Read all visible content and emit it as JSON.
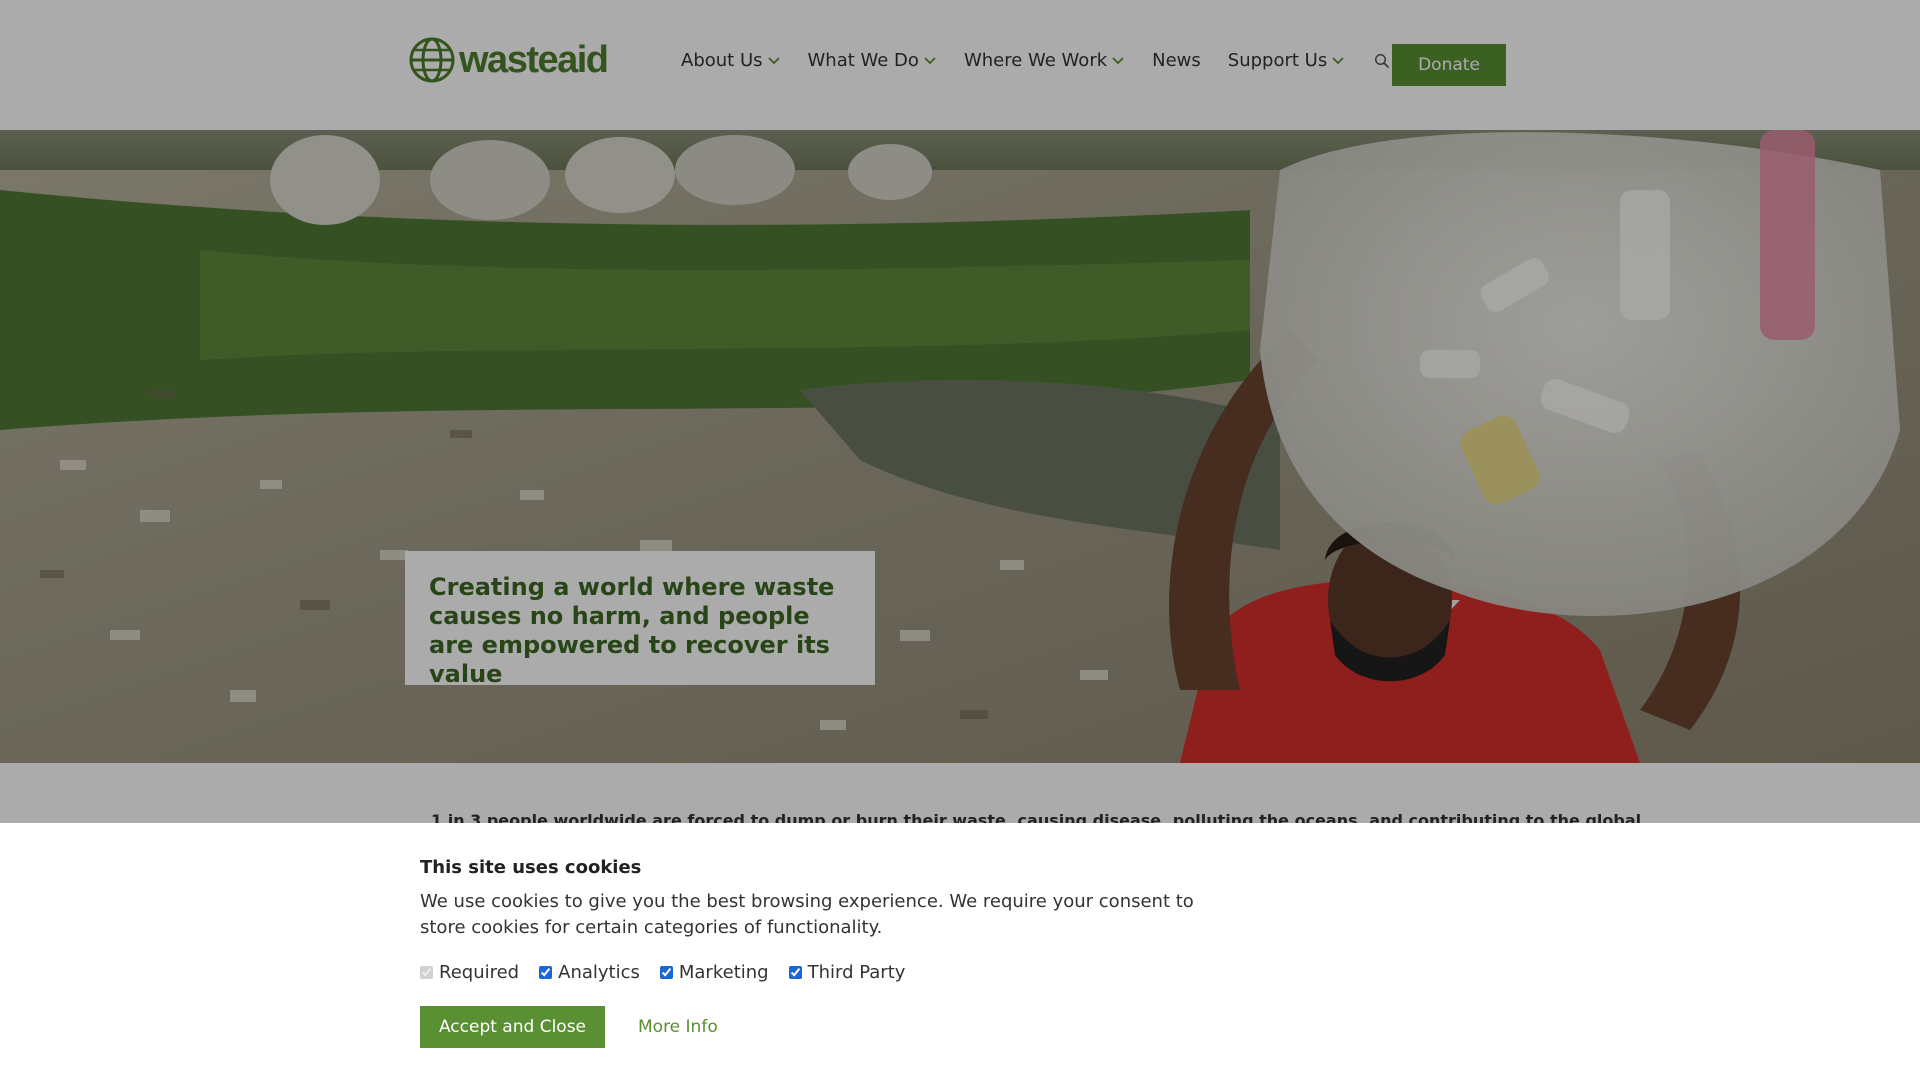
{
  "brand": {
    "logo_text": "wasteaid",
    "accent_color": "#5a8f34",
    "logo_icon": "globe-icon"
  },
  "nav": {
    "items": [
      {
        "label": "About Us",
        "has_dropdown": true
      },
      {
        "label": "What We Do",
        "has_dropdown": true
      },
      {
        "label": "Where We Work",
        "has_dropdown": true
      },
      {
        "label": "News",
        "has_dropdown": false
      },
      {
        "label": "Support Us",
        "has_dropdown": true
      }
    ],
    "search_icon": "search-icon",
    "donate_label": "Donate"
  },
  "hero": {
    "tagline": "Creating a world where waste causes no harm, and people are empowered to recover its value",
    "image_description_icon": "hero-photo"
  },
  "intro": {
    "text": "1 in 3 people worldwide are forced to dump or burn their waste, causing disease, polluting the oceans, and contributing to the global"
  },
  "cookie_banner": {
    "title": "This site uses cookies",
    "description": "We use cookies to give you the best browsing experience. We require your consent to store cookies for certain categories of functionality.",
    "options": [
      {
        "label": "Required",
        "checked": true,
        "disabled": true
      },
      {
        "label": "Analytics",
        "checked": true,
        "disabled": false
      },
      {
        "label": "Marketing",
        "checked": true,
        "disabled": false
      },
      {
        "label": "Third Party",
        "checked": true,
        "disabled": false
      }
    ],
    "accept_label": "Accept and Close",
    "more_info_label": "More Info"
  }
}
